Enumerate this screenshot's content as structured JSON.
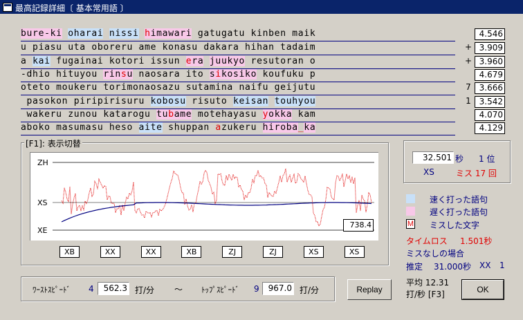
{
  "title": "最高記録詳細〔 基本常用語 〕",
  "lines": [
    {
      "mark": "",
      "time": "4.546",
      "segs": [
        {
          "t": "bure-ki",
          "c": "slow"
        },
        {
          "t": " "
        },
        {
          "t": "oharai",
          "c": "fast"
        },
        {
          "t": " "
        },
        {
          "t": "nissi",
          "c": "fast"
        },
        {
          "t": " "
        },
        {
          "t": "h",
          "c": "miss slow"
        },
        {
          "t": "imawari",
          "c": "slow"
        },
        {
          "t": " gatugatu kinben maik"
        }
      ]
    },
    {
      "mark": "+",
      "time": "3.909",
      "segs": [
        {
          "t": "u piasu uta oboreru ame konasu dakara hihan tadaim"
        }
      ]
    },
    {
      "mark": "+",
      "time": "3.960",
      "segs": [
        {
          "t": "a "
        },
        {
          "t": "kai",
          "c": "fast"
        },
        {
          "t": " fugainai kotori issun "
        },
        {
          "t": "e",
          "c": "miss slow"
        },
        {
          "t": "ra",
          "c": "slow"
        },
        {
          "t": " "
        },
        {
          "t": "juukyo",
          "c": "slow"
        },
        {
          "t": " resutoran o"
        }
      ]
    },
    {
      "mark": "",
      "time": "4.679",
      "segs": [
        {
          "t": "-dhio hituyou "
        },
        {
          "t": "rin",
          "c": "slow"
        },
        {
          "t": "s",
          "c": "miss slow"
        },
        {
          "t": "u",
          "c": "slow"
        },
        {
          "t": " naosara ito "
        },
        {
          "t": "s",
          "c": "slow"
        },
        {
          "t": "i",
          "c": "miss slow"
        },
        {
          "t": "kosiko",
          "c": "slow"
        },
        {
          "t": " koufuku p"
        }
      ]
    },
    {
      "mark": "7",
      "time": "3.666",
      "segs": [
        {
          "t": "oteto moukeru torimonaosazu sutamina naifu geijutu"
        }
      ]
    },
    {
      "mark": "1",
      "time": "3.542",
      "segs": [
        {
          "t": " pasokon piripirisuru "
        },
        {
          "t": "kobosu",
          "c": "fast"
        },
        {
          "t": " risuto "
        },
        {
          "t": "keisan",
          "c": "fast"
        },
        {
          "t": " "
        },
        {
          "t": "touhyou",
          "c": "fast"
        }
      ]
    },
    {
      "mark": "",
      "time": "4.070",
      "segs": [
        {
          "t": " wakeru zunou katarogu "
        },
        {
          "t": "tu",
          "c": "slow"
        },
        {
          "t": "b",
          "c": "miss slow"
        },
        {
          "t": "ame",
          "c": "slow"
        },
        {
          "t": " motehayasu "
        },
        {
          "t": "y",
          "c": "miss slow"
        },
        {
          "t": "okka",
          "c": "slow"
        },
        {
          "t": " kam"
        }
      ]
    },
    {
      "mark": "",
      "time": "4.129",
      "segs": [
        {
          "t": "aboko masumasu heso "
        },
        {
          "t": "aite",
          "c": "fast"
        },
        {
          "t": " shuppan "
        },
        {
          "t": "a",
          "c": "miss"
        },
        {
          "t": "zukeru "
        },
        {
          "t": "hiroba",
          "c": "slow"
        },
        {
          "t": "_",
          "c": "miss"
        },
        {
          "t": "ka",
          "c": "slow"
        }
      ]
    }
  ],
  "graph": {
    "group_title": "[F1]: 表示切替",
    "axis_labels": [
      "ZH",
      "XS",
      "XE"
    ],
    "current_value": "738.4",
    "ranks": [
      "XB",
      "XX",
      "XX",
      "XB",
      "ZJ",
      "ZJ",
      "XS",
      "XS"
    ]
  },
  "result": {
    "time": "32.501",
    "sec_unit": "秒",
    "rank_pos": "1 位",
    "grade": "XS",
    "miss": "ミス 17 回"
  },
  "legend": {
    "fast": "速く打った語句",
    "slow": "遅く打った語句",
    "miss_marker": "M",
    "miss": "ミスした文字"
  },
  "timeloss": {
    "label": "タイムロス",
    "value": "1.501秒",
    "nomiss_label": "ミスなしの場合",
    "estimate_label": "推定",
    "estimate_value": "31.000秒",
    "estimate_grade": "XX",
    "estimate_rank": "1"
  },
  "speeds": {
    "worst_label": "ﾜｰｽﾄｽﾋﾟｰﾄﾞ",
    "worst_idx": "4",
    "worst_val": "562.3",
    "unit": "打/分",
    "tilde": "～",
    "top_label": "ﾄｯﾌﾟｽﾋﾟｰﾄﾞ",
    "top_idx": "9",
    "top_val": "967.0"
  },
  "avg": {
    "line1": "平均 12.31",
    "line2": "打/秒 [F3]"
  },
  "buttons": {
    "replay": "Replay",
    "ok": "OK"
  },
  "colors": {
    "fast_bg": "#c8e0f8",
    "slow_bg": "#f8c8e8",
    "miss_text": "#e00000",
    "speed_line": "#e00000",
    "avg_line": "#000080"
  }
}
